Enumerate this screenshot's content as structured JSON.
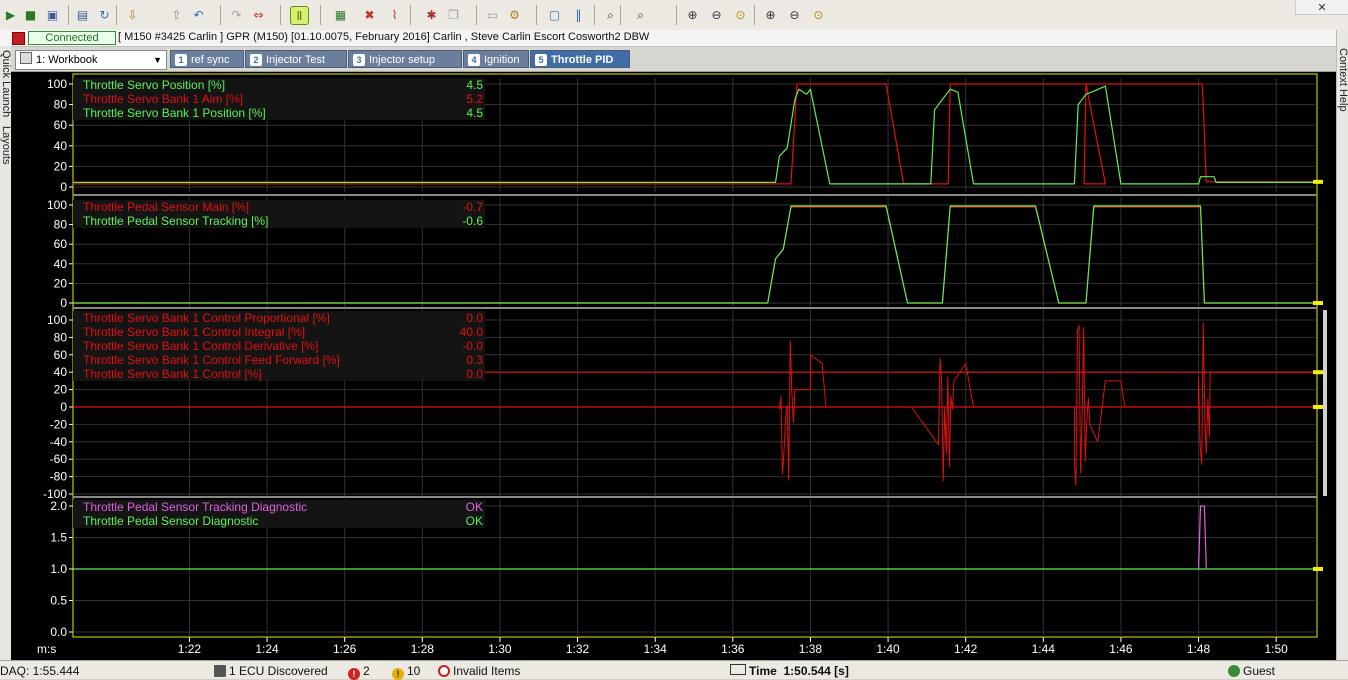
{
  "toolbar": {
    "close_glyph": "✕",
    "icons": [
      "go-online-icon",
      "go-offline-icon",
      "save-icon",
      "save-as-icon",
      "refresh-icon",
      "import-icon",
      "export-icon",
      "undo-icon",
      "redo-icon",
      "compare-icon",
      "pause-icon",
      "grid-icon",
      "clear-icon",
      "trace-icon",
      "bug-icon",
      "copy-icon",
      "paste-icon",
      "settings-icon",
      "window-icon",
      "bars-icon",
      "search-icon",
      "search-next-icon",
      "zoom-in-icon",
      "zoom-out-icon",
      "zoom-fit-icon",
      "zoom-in-x-icon",
      "zoom-out-x-icon",
      "zoom-fit-x-icon"
    ]
  },
  "connection": {
    "status": "Connected",
    "ecu_info": "[ M150 #3425 Carlin ]  GPR (M150) [01.10.0075, February 2016] Carlin , Steve Carlin Escort Cosworth2 DBW"
  },
  "side": {
    "left": [
      "Quick Launch",
      "Layouts"
    ],
    "right": "Context Help"
  },
  "workbook": {
    "selected": "1: Workbook",
    "tabs": [
      {
        "num": "1",
        "label": "ref sync",
        "active": false
      },
      {
        "num": "2",
        "label": "Injector Test",
        "active": false
      },
      {
        "num": "3",
        "label": "Injector setup",
        "active": false
      },
      {
        "num": "4",
        "label": "Ignition",
        "active": false
      },
      {
        "num": "5",
        "label": "Throttle PID",
        "active": true
      }
    ]
  },
  "colors": {
    "green": "#5ef055",
    "red": "#e01010",
    "pink": "#e060e0",
    "axis": "#ffffff",
    "grid": "#333333",
    "frame": "#e8e800",
    "marker": "#f0f000"
  },
  "chart_data": [
    {
      "type": "line",
      "ylim": [
        0,
        100
      ],
      "yticks": [
        "100",
        "80",
        "60",
        "40",
        "20",
        "0"
      ],
      "series": [
        {
          "name": "Throttle Servo Position [%]",
          "value": "4.5",
          "color": "#5ef055"
        },
        {
          "name": "Throttle Servo Bank 1 Aim [%]",
          "value": "5.2",
          "color": "#e01010"
        },
        {
          "name": "Throttle Servo Bank 1 Position [%]",
          "value": "4.5",
          "color": "#5ef055"
        }
      ]
    },
    {
      "type": "line",
      "ylim": [
        0,
        100
      ],
      "yticks": [
        "100",
        "80",
        "60",
        "40",
        "20",
        "0"
      ],
      "series": [
        {
          "name": "Throttle Pedal Sensor Main [%]",
          "value": "-0.7",
          "color": "#e01010"
        },
        {
          "name": "Throttle Pedal Sensor Tracking [%]",
          "value": "-0.6",
          "color": "#5ef055"
        }
      ]
    },
    {
      "type": "line",
      "ylim": [
        -100,
        100
      ],
      "yticks": [
        "100",
        "80",
        "60",
        "40",
        "20",
        "0",
        "-20",
        "-40",
        "-60",
        "-80",
        "-100"
      ],
      "series": [
        {
          "name": "Throttle Servo Bank 1 Control Proportional [%]",
          "value": "0.0",
          "color": "#e01010"
        },
        {
          "name": "Throttle Servo Bank 1 Control Integral [%]",
          "value": "40.0",
          "color": "#e01010"
        },
        {
          "name": "Throttle Servo Bank 1 Control Derivative [%]",
          "value": "-0.0",
          "color": "#e01010"
        },
        {
          "name": "Throttle Servo Bank 1 Control Feed Forward [%]",
          "value": "0.3",
          "color": "#e01010"
        },
        {
          "name": "Throttle Servo Bank 1 Control [%]",
          "value": "0.0",
          "color": "#e01010"
        }
      ]
    },
    {
      "type": "line",
      "ylim": [
        0,
        2
      ],
      "yticks": [
        "2.0",
        "1.5",
        "1.0",
        "0.5",
        "0.0"
      ],
      "series": [
        {
          "name": "Throttle Pedal Sensor Tracking Diagnostic",
          "value": "OK",
          "color": "#e060e0"
        },
        {
          "name": "Throttle Pedal Sensor Diagnostic",
          "value": "OK",
          "color": "#5ef055"
        }
      ]
    }
  ],
  "time_axis": {
    "unit_label": "m:s",
    "range_s": [
      79.0,
      111.0
    ],
    "ticks": [
      {
        "t": 82,
        "label": "1:22"
      },
      {
        "t": 84,
        "label": "1:24"
      },
      {
        "t": 86,
        "label": "1:26"
      },
      {
        "t": 88,
        "label": "1:28"
      },
      {
        "t": 90,
        "label": "1:30"
      },
      {
        "t": 92,
        "label": "1:32"
      },
      {
        "t": 94,
        "label": "1:34"
      },
      {
        "t": 96,
        "label": "1:36"
      },
      {
        "t": 98,
        "label": "1:38"
      },
      {
        "t": 100,
        "label": "1:40"
      },
      {
        "t": 102,
        "label": "1:42"
      },
      {
        "t": 104,
        "label": "1:44"
      },
      {
        "t": 106,
        "label": "1:46"
      },
      {
        "t": 108,
        "label": "1:48"
      },
      {
        "t": 110,
        "label": "1:50"
      }
    ]
  },
  "status": {
    "daq": "DAQ: 1:55.444",
    "ecu": "1 ECU Discovered",
    "errors": "2",
    "warnings": "10",
    "invalid": "Invalid Items",
    "time_label": "Time",
    "time_value": "1:50.544 [s]",
    "user": "Guest"
  }
}
